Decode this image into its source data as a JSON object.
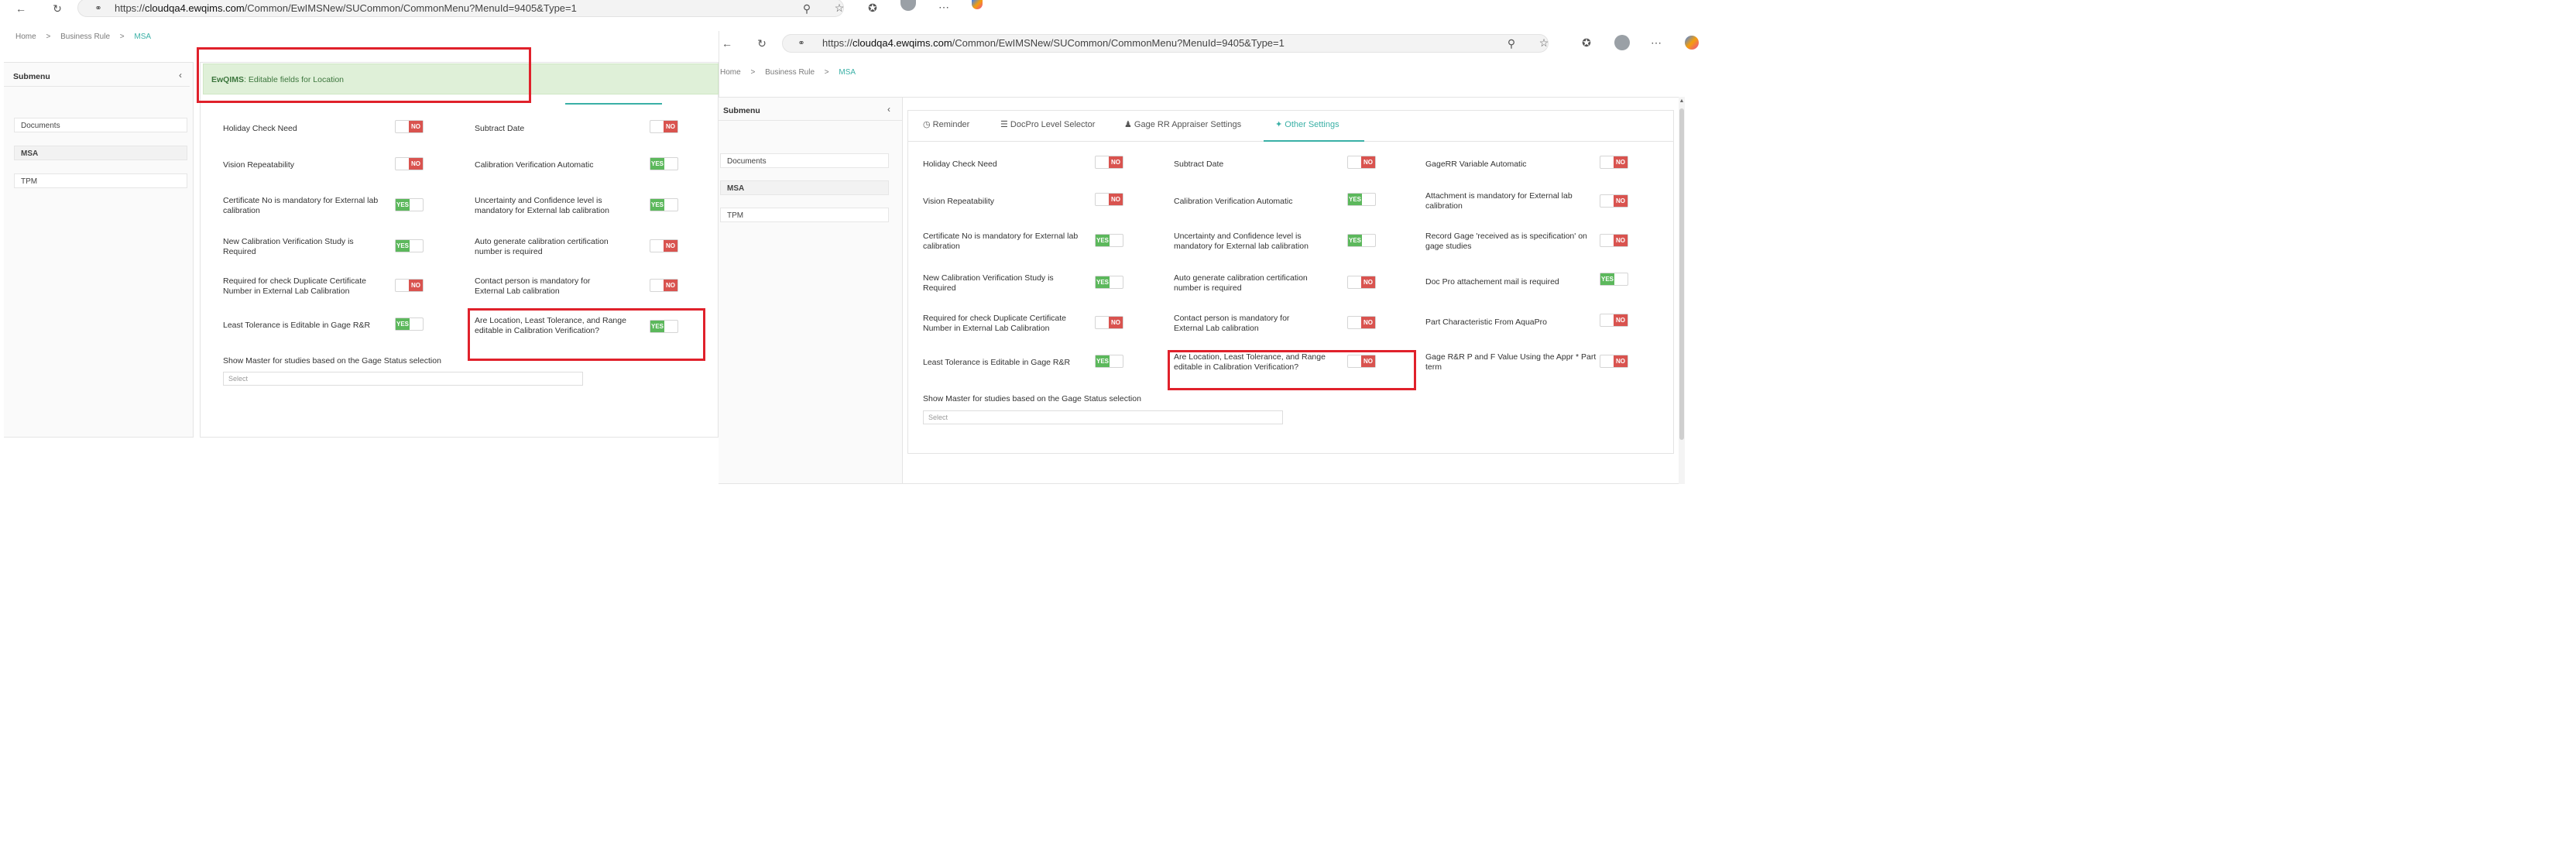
{
  "left": {
    "url_host": "cloudqa4.ewqims.com",
    "url_path": "/Common/EwIMSNew/SUCommon/CommonMenu?MenuId=9405&Type=1",
    "url_prefix": "https://",
    "breadcrumb": [
      "Home",
      "Business Rule",
      "MSA"
    ],
    "submenu_title": "Submenu",
    "submenu_items": [
      "Documents",
      "MSA",
      "TPM"
    ],
    "toast_brand": "EwQIMS",
    "toast_message": ": Editable fields for Location",
    "rows": [
      {
        "label": "Holiday Check Need",
        "value": "NO"
      },
      {
        "label": "Subtract Date",
        "value": "NO"
      },
      {
        "label": "Vision Repeatability",
        "value": "NO"
      },
      {
        "label": "Calibration Verification Automatic",
        "value": "YES"
      },
      {
        "label": "Certificate No is mandatory for External lab calibration",
        "value": "YES"
      },
      {
        "label": "Uncertainty and Confidence level is mandatory for External lab calibration",
        "value": "YES"
      },
      {
        "label": "New Calibration Verification Study is Required",
        "value": "YES"
      },
      {
        "label": "Auto generate calibration certification number is required",
        "value": "NO"
      },
      {
        "label": "Required for check Duplicate Certificate Number in External Lab Calibration",
        "value": "NO"
      },
      {
        "label": "Contact person is mandatory for External Lab calibration",
        "value": "NO"
      },
      {
        "label": "Least Tolerance is Editable in Gage R&R",
        "value": "YES"
      },
      {
        "label": "Are Location, Least Tolerance, and Range editable in Calibration Verification?",
        "value": "YES"
      }
    ],
    "master_label": "Show Master for studies based on the Gage Status selection",
    "select_placeholder": "Select"
  },
  "right": {
    "url_prefix": "https://",
    "url_host": "cloudqa4.ewqims.com",
    "url_path": "/Common/EwIMSNew/SUCommon/CommonMenu?MenuId=9405&Type=1",
    "breadcrumb": [
      "Home",
      "Business Rule",
      "MSA"
    ],
    "submenu_title": "Submenu",
    "submenu_items": [
      "Documents",
      "MSA",
      "TPM"
    ],
    "tabs": [
      "Reminder",
      "DocPro Level Selector",
      "Gage RR Appraiser Settings",
      "Other Settings"
    ],
    "rows": [
      {
        "label": "Holiday Check Need",
        "value": "NO"
      },
      {
        "label": "Subtract Date",
        "value": "NO"
      },
      {
        "label": "GageRR Variable Automatic",
        "value": "NO"
      },
      {
        "label": "Vision Repeatability",
        "value": "NO"
      },
      {
        "label": "Calibration Verification Automatic",
        "value": "YES"
      },
      {
        "label": "Attachment is mandatory for External lab calibration",
        "value": "NO"
      },
      {
        "label": "Certificate No is mandatory for External lab calibration",
        "value": "YES"
      },
      {
        "label": "Uncertainty and Confidence level is mandatory for External lab calibration",
        "value": "YES"
      },
      {
        "label": "Record Gage 'received as is specification' on gage studies",
        "value": "NO"
      },
      {
        "label": "New Calibration Verification Study is Required",
        "value": "YES"
      },
      {
        "label": "Auto generate calibration certification number is required",
        "value": "NO"
      },
      {
        "label": "Doc Pro attachement mail is required",
        "value": "YES"
      },
      {
        "label": "Required for check Duplicate Certificate Number in External Lab Calibration",
        "value": "NO"
      },
      {
        "label": "Contact person is mandatory for External Lab calibration",
        "value": "NO"
      },
      {
        "label": "Part Characteristic From AquaPro",
        "value": "NO"
      },
      {
        "label": "Least Tolerance is Editable in Gage R&R",
        "value": "YES"
      },
      {
        "label": "Are Location, Least Tolerance, and Range editable in Calibration Verification?",
        "value": "NO"
      },
      {
        "label": "Gage R&R P and F Value Using the Appr * Part term",
        "value": "NO"
      }
    ],
    "master_label": "Show Master for studies based on the Gage Status selection",
    "select_placeholder": "Select"
  }
}
